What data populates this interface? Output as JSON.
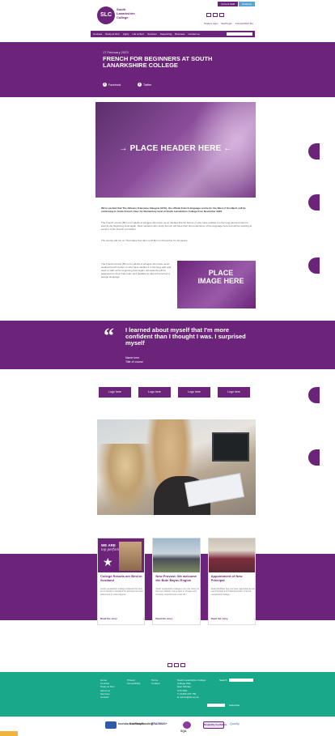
{
  "colors": {
    "brand": "#6b2479",
    "footer": "#1aa88a",
    "accent": "#5ba3d6"
  },
  "header": {
    "logo_initials": "SLC",
    "logo_lines": [
      "South",
      "Lanarkshire",
      "College"
    ],
    "top_tabs": [
      "Current Staff",
      "Students"
    ],
    "top_links": [
      "Student login",
      "Staff login",
      "Contact/Worl.fbe"
    ],
    "nav": [
      "Courses",
      "Study at SLC",
      "Apply",
      "Life at SLC",
      "Services",
      "Supporting",
      "Business",
      "Contact us"
    ]
  },
  "hero": {
    "date": "17 February 2023",
    "title": "FRENCH FOR BEGINNERS AT SOUTH LANARKSHIRE COLLEGE",
    "share_facebook": "Facebook",
    "share_twitter": "Twitter"
  },
  "header_image": {
    "label": "→ PLACE HEADER HERE ←"
  },
  "body": {
    "lead": "We're excited that The Alliance Française Glasgow (AFG), the official French language centre for the West of Scotland, will be continuing to invite French class for Elementary level at South Lanarkshire College from November 2023.",
    "p1": "The French course (B1) is for adults of all ages who have never studied French before or who have studied it in the long past and want to start at the beginning level again. Most students who study French will have their first experience of the language here and will be working at Level 1 of the French curriculum.",
    "p2": "The course will run on Thursdays from 6pm until 8pm in November for 10 weeks.",
    "p3": "The French course (B1) is for adults of all ages who have never studied French before or who have studied it in the long past and want to start at the beginning level again. All students will be assessed on their final exam and qualified to attend French as a foreign language."
  },
  "place_image": {
    "label": "PLACE IMAGE HERE"
  },
  "quote": {
    "mark": "“",
    "text": "I learned about myself that I'm more confident than I thought I was. I surprised myself",
    "name": "Name here",
    "course": "Title of course"
  },
  "logo_buttons": [
    "Logo here",
    "Logo here",
    "Logo here",
    "Logo here"
  ],
  "news": [
    {
      "title": "College Results are Best in Scotland",
      "text": "South Lanarkshire College achieved the best set of results in Scotland for achievement and attainment in recent figures.",
      "link": "Read the story",
      "badge_line1": "WE ARE",
      "badge_line2": "top performing"
    },
    {
      "title": "New Provost: We welcome the Bute Bayou Engine",
      "text": "South Lanarkshire College is not only home for the new Cabinet, but is open to all ages and currently most famous in the UK.",
      "link": "Read the story"
    },
    {
      "title": "Appointment of New Principal",
      "text": "Stuart McKillop has now been appointed as the new Principal and Chief Executive of South Lanarkshire College.",
      "link": "Read the story"
    }
  ],
  "footer": {
    "col1": [
      "Home",
      "Courses",
      "Study at SLC",
      "About us",
      "Services",
      "Contact"
    ],
    "col2": [
      "Privacy",
      "Accessibility"
    ],
    "col3": [
      "Terms",
      "Cookies"
    ],
    "address": [
      "South Lanarkshire College",
      "College Way",
      "East Kilbride",
      "G75 0NE",
      "T: 01355 270 750",
      "E: admin@slc.ac.uk"
    ],
    "search_label": "Search",
    "subscribe_label": "Subscribe"
  },
  "partners": [
    "Investors in People",
    "Scottish Funding",
    "ERASMUS+",
    "SQA",
    "Disability Confident",
    "Quality"
  ]
}
